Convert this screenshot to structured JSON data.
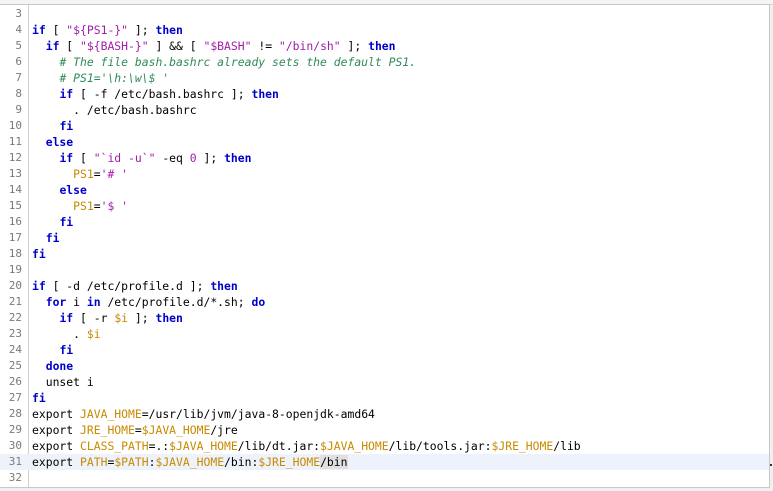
{
  "colors": {
    "keyword": "#0000cc",
    "string": "#a21daa",
    "variable": "#c88a00",
    "comment": "#2e8b57",
    "line_number": "#7a7a7a",
    "current_line": "#eef3fb"
  },
  "editor": {
    "current_line": 31,
    "lines": [
      {
        "n": "3",
        "tokens": []
      },
      {
        "n": "4",
        "tokens": [
          {
            "t": "kw",
            "v": "if"
          },
          {
            "t": "txt",
            "v": " [ "
          },
          {
            "t": "str",
            "v": "\"${PS1-}\""
          },
          {
            "t": "txt",
            "v": " ]; "
          },
          {
            "t": "kw",
            "v": "then"
          }
        ]
      },
      {
        "n": "5",
        "tokens": [
          {
            "t": "txt",
            "v": "  "
          },
          {
            "t": "kw",
            "v": "if"
          },
          {
            "t": "txt",
            "v": " [ "
          },
          {
            "t": "str",
            "v": "\"${BASH-}\""
          },
          {
            "t": "txt",
            "v": " ] && [ "
          },
          {
            "t": "str",
            "v": "\"$BASH\""
          },
          {
            "t": "txt",
            "v": " != "
          },
          {
            "t": "str",
            "v": "\"/bin/sh\""
          },
          {
            "t": "txt",
            "v": " ]; "
          },
          {
            "t": "kw",
            "v": "then"
          }
        ]
      },
      {
        "n": "6",
        "tokens": [
          {
            "t": "txt",
            "v": "    "
          },
          {
            "t": "cmt",
            "v": "# The file bash.bashrc already sets the default PS1."
          }
        ]
      },
      {
        "n": "7",
        "tokens": [
          {
            "t": "txt",
            "v": "    "
          },
          {
            "t": "cmt",
            "v": "# PS1='\\h:\\w\\$ '"
          }
        ]
      },
      {
        "n": "8",
        "tokens": [
          {
            "t": "txt",
            "v": "    "
          },
          {
            "t": "kw",
            "v": "if"
          },
          {
            "t": "txt",
            "v": " [ -f /etc/bash.bashrc ]; "
          },
          {
            "t": "kw",
            "v": "then"
          }
        ]
      },
      {
        "n": "9",
        "tokens": [
          {
            "t": "txt",
            "v": "      . /etc/bash.bashrc"
          }
        ]
      },
      {
        "n": "10",
        "tokens": [
          {
            "t": "txt",
            "v": "    "
          },
          {
            "t": "kw",
            "v": "fi"
          }
        ]
      },
      {
        "n": "11",
        "tokens": [
          {
            "t": "txt",
            "v": "  "
          },
          {
            "t": "kw",
            "v": "else"
          }
        ]
      },
      {
        "n": "12",
        "tokens": [
          {
            "t": "txt",
            "v": "    "
          },
          {
            "t": "kw",
            "v": "if"
          },
          {
            "t": "txt",
            "v": " [ "
          },
          {
            "t": "str",
            "v": "\"`id -u`\""
          },
          {
            "t": "txt",
            "v": " -eq "
          },
          {
            "t": "str",
            "v": "0"
          },
          {
            "t": "txt",
            "v": " ]; "
          },
          {
            "t": "kw",
            "v": "then"
          }
        ]
      },
      {
        "n": "13",
        "tokens": [
          {
            "t": "txt",
            "v": "      "
          },
          {
            "t": "var",
            "v": "PS1"
          },
          {
            "t": "txt",
            "v": "="
          },
          {
            "t": "str",
            "v": "'# '"
          }
        ]
      },
      {
        "n": "14",
        "tokens": [
          {
            "t": "txt",
            "v": "    "
          },
          {
            "t": "kw",
            "v": "else"
          }
        ]
      },
      {
        "n": "15",
        "tokens": [
          {
            "t": "txt",
            "v": "      "
          },
          {
            "t": "var",
            "v": "PS1"
          },
          {
            "t": "txt",
            "v": "="
          },
          {
            "t": "str",
            "v": "'$ '"
          }
        ]
      },
      {
        "n": "16",
        "tokens": [
          {
            "t": "txt",
            "v": "    "
          },
          {
            "t": "kw",
            "v": "fi"
          }
        ]
      },
      {
        "n": "17",
        "tokens": [
          {
            "t": "txt",
            "v": "  "
          },
          {
            "t": "kw",
            "v": "fi"
          }
        ]
      },
      {
        "n": "18",
        "tokens": [
          {
            "t": "kw",
            "v": "fi"
          }
        ]
      },
      {
        "n": "19",
        "tokens": []
      },
      {
        "n": "20",
        "tokens": [
          {
            "t": "kw",
            "v": "if"
          },
          {
            "t": "txt",
            "v": " [ -d /etc/profile.d ]; "
          },
          {
            "t": "kw",
            "v": "then"
          }
        ]
      },
      {
        "n": "21",
        "tokens": [
          {
            "t": "txt",
            "v": "  "
          },
          {
            "t": "kw",
            "v": "for"
          },
          {
            "t": "txt",
            "v": " i "
          },
          {
            "t": "kw",
            "v": "in"
          },
          {
            "t": "txt",
            "v": " /etc/profile.d/*.sh; "
          },
          {
            "t": "kw",
            "v": "do"
          }
        ]
      },
      {
        "n": "22",
        "tokens": [
          {
            "t": "txt",
            "v": "    "
          },
          {
            "t": "kw",
            "v": "if"
          },
          {
            "t": "txt",
            "v": " [ -r "
          },
          {
            "t": "var",
            "v": "$i"
          },
          {
            "t": "txt",
            "v": " ]; "
          },
          {
            "t": "kw",
            "v": "then"
          }
        ]
      },
      {
        "n": "23",
        "tokens": [
          {
            "t": "txt",
            "v": "      . "
          },
          {
            "t": "var",
            "v": "$i"
          }
        ]
      },
      {
        "n": "24",
        "tokens": [
          {
            "t": "txt",
            "v": "    "
          },
          {
            "t": "kw",
            "v": "fi"
          }
        ]
      },
      {
        "n": "25",
        "tokens": [
          {
            "t": "txt",
            "v": "  "
          },
          {
            "t": "kw",
            "v": "done"
          }
        ]
      },
      {
        "n": "26",
        "tokens": [
          {
            "t": "txt",
            "v": "  unset i"
          }
        ]
      },
      {
        "n": "27",
        "tokens": [
          {
            "t": "kw",
            "v": "fi"
          }
        ]
      },
      {
        "n": "28",
        "tokens": [
          {
            "t": "txt",
            "v": "export "
          },
          {
            "t": "var",
            "v": "JAVA_HOME"
          },
          {
            "t": "txt",
            "v": "=/usr/lib/jvm/java-8-openjdk-amd64"
          }
        ]
      },
      {
        "n": "29",
        "tokens": [
          {
            "t": "txt",
            "v": "export "
          },
          {
            "t": "var",
            "v": "JRE_HOME"
          },
          {
            "t": "txt",
            "v": "="
          },
          {
            "t": "var",
            "v": "$JAVA_HOME"
          },
          {
            "t": "txt",
            "v": "/jre"
          }
        ]
      },
      {
        "n": "30",
        "tokens": [
          {
            "t": "txt",
            "v": "export "
          },
          {
            "t": "var",
            "v": "CLASS_PATH"
          },
          {
            "t": "txt",
            "v": "=.:"
          },
          {
            "t": "var",
            "v": "$JAVA_HOME"
          },
          {
            "t": "txt",
            "v": "/lib/dt.jar:"
          },
          {
            "t": "var",
            "v": "$JAVA_HOME"
          },
          {
            "t": "txt",
            "v": "/lib/tools.jar:"
          },
          {
            "t": "var",
            "v": "$JRE_HOME"
          },
          {
            "t": "txt",
            "v": "/lib"
          }
        ]
      },
      {
        "n": "31",
        "tokens": [
          {
            "t": "txt",
            "v": "export "
          },
          {
            "t": "var",
            "v": "PATH"
          },
          {
            "t": "txt",
            "v": "="
          },
          {
            "t": "var",
            "v": "$PATH"
          },
          {
            "t": "txt",
            "v": ":"
          },
          {
            "t": "var",
            "v": "$JAVA_HOME"
          },
          {
            "t": "txt",
            "v": "/bin:"
          },
          {
            "t": "var",
            "v": "$JRE_HOME"
          },
          {
            "t": "sel",
            "v": "/bin"
          }
        ]
      },
      {
        "n": "32",
        "tokens": []
      }
    ]
  }
}
